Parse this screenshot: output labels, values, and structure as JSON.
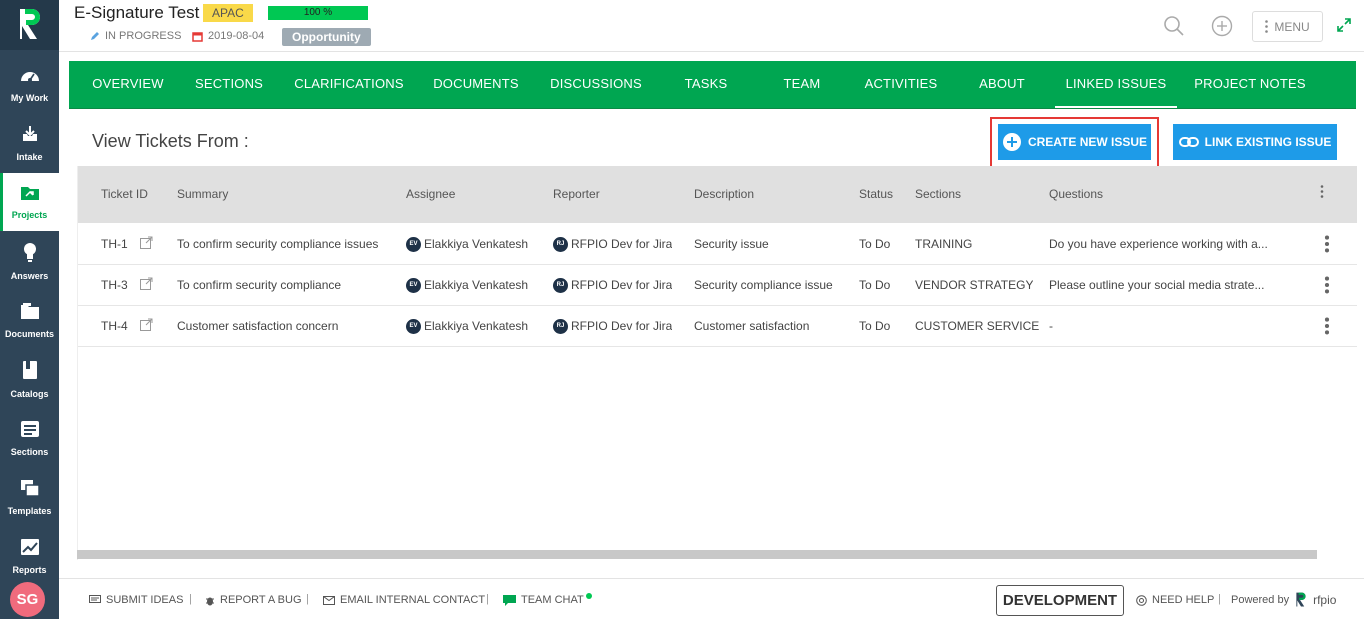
{
  "brand": {
    "accent": "#00a651",
    "button_blue": "#1e9be8",
    "rail": "#2f4558"
  },
  "header": {
    "title": "E-Signature Test",
    "region": "APAC",
    "progress": "100 %",
    "progress_value": 1.0,
    "status": "IN PROGRESS",
    "date": "2019-08-04",
    "type": "Opportunity",
    "menu_label": "MENU"
  },
  "sidebar": {
    "items": [
      {
        "label": "My Work",
        "icon": "gauge-icon"
      },
      {
        "label": "Intake",
        "icon": "inbox-download-icon"
      },
      {
        "label": "Projects",
        "icon": "folder-icon",
        "active": true
      },
      {
        "label": "Answers",
        "icon": "lightbulb-icon"
      },
      {
        "label": "Documents",
        "icon": "documents-icon"
      },
      {
        "label": "Catalogs",
        "icon": "book-icon"
      },
      {
        "label": "Sections",
        "icon": "sections-icon"
      },
      {
        "label": "Templates",
        "icon": "templates-icon"
      },
      {
        "label": "Reports",
        "icon": "chart-image-icon"
      }
    ],
    "user_initials": "SG"
  },
  "nav": {
    "tabs": [
      {
        "label": "OVERVIEW"
      },
      {
        "label": "SECTIONS"
      },
      {
        "label": "CLARIFICATIONS"
      },
      {
        "label": "DOCUMENTS"
      },
      {
        "label": "DISCUSSIONS"
      },
      {
        "label": "TASKS"
      },
      {
        "label": "TEAM"
      },
      {
        "label": "ACTIVITIES"
      },
      {
        "label": "ABOUT"
      },
      {
        "label": "LINKED ISSUES",
        "active": true
      },
      {
        "label": "PROJECT NOTES"
      }
    ]
  },
  "main": {
    "view_label": "View Tickets From :",
    "create_button": "CREATE NEW ISSUE",
    "link_button": "LINK EXISTING ISSUE"
  },
  "table": {
    "columns": [
      "Ticket ID",
      "Summary",
      "Assignee",
      "Reporter",
      "Description",
      "Status",
      "Sections",
      "Questions"
    ],
    "rows": [
      {
        "id": "TH-1",
        "summary": "To confirm security compliance issues",
        "assignee_initials": "EV",
        "assignee": "Elakkiya Venkatesh",
        "reporter_initials": "RJ",
        "reporter": "RFPIO Dev for Jira",
        "description": "Security issue",
        "status": "To Do",
        "section": "TRAINING",
        "question": "Do you have experience working with a..."
      },
      {
        "id": "TH-3",
        "summary": "To confirm security compliance",
        "assignee_initials": "EV",
        "assignee": "Elakkiya Venkatesh",
        "reporter_initials": "RJ",
        "reporter": "RFPIO Dev for Jira",
        "description": "Security compliance issue",
        "status": "To Do",
        "section": "VENDOR STRATEGY",
        "question": "Please outline your social media strate..."
      },
      {
        "id": "TH-4",
        "summary": "Customer satisfaction concern",
        "assignee_initials": "EV",
        "assignee": "Elakkiya Venkatesh",
        "reporter_initials": "RJ",
        "reporter": "RFPIO Dev for Jira",
        "description": "Customer satisfaction",
        "status": "To Do",
        "section": "CUSTOMER SERVICE",
        "question": "-"
      }
    ]
  },
  "footer": {
    "submit_ideas": "SUBMIT IDEAS",
    "report_bug": "REPORT A BUG",
    "email_contact": "EMAIL INTERNAL CONTACT",
    "team_chat": "TEAM CHAT",
    "environment": "DEVELOPMENT",
    "need_help": "NEED HELP",
    "powered_by": "Powered by",
    "brand_name": "rfpio"
  }
}
